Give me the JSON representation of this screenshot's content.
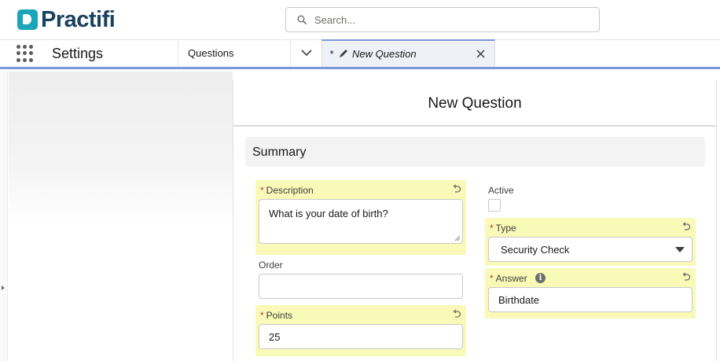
{
  "header": {
    "logo_text": "Practifi",
    "search": {
      "placeholder": "Search..."
    }
  },
  "nav": {
    "app_name": "Settings",
    "item_label": "Questions",
    "active_tab": {
      "modified_marker": "*",
      "label": "New Question"
    }
  },
  "modal": {
    "title": "New Question",
    "section_title": "Summary",
    "fields": {
      "description": {
        "required_marker": "*",
        "label": "Description",
        "value": "What is your date of birth?"
      },
      "order": {
        "label": "Order",
        "value": ""
      },
      "points": {
        "required_marker": "*",
        "label": "Points",
        "value": "25"
      },
      "active": {
        "label": "Active",
        "checked": false
      },
      "type": {
        "required_marker": "*",
        "label": "Type",
        "value": "Security Check"
      },
      "answer": {
        "required_marker": "*",
        "label": "Answer",
        "info_glyph": "i",
        "value": "Birthdate"
      }
    }
  },
  "colors": {
    "brand_teal": "#1aa6b7",
    "brand_navy": "#19425f",
    "tab_accent": "#7c97d8",
    "highlight": "#f9f9b8",
    "required": "#c23934"
  },
  "icons": [
    "logo-mark-icon",
    "search-icon",
    "app-launcher-icon",
    "chevron-down-icon",
    "pencil-icon",
    "close-icon",
    "undo-icon",
    "info-icon",
    "dropdown-arrow-icon",
    "panel-toggle-icon"
  ]
}
